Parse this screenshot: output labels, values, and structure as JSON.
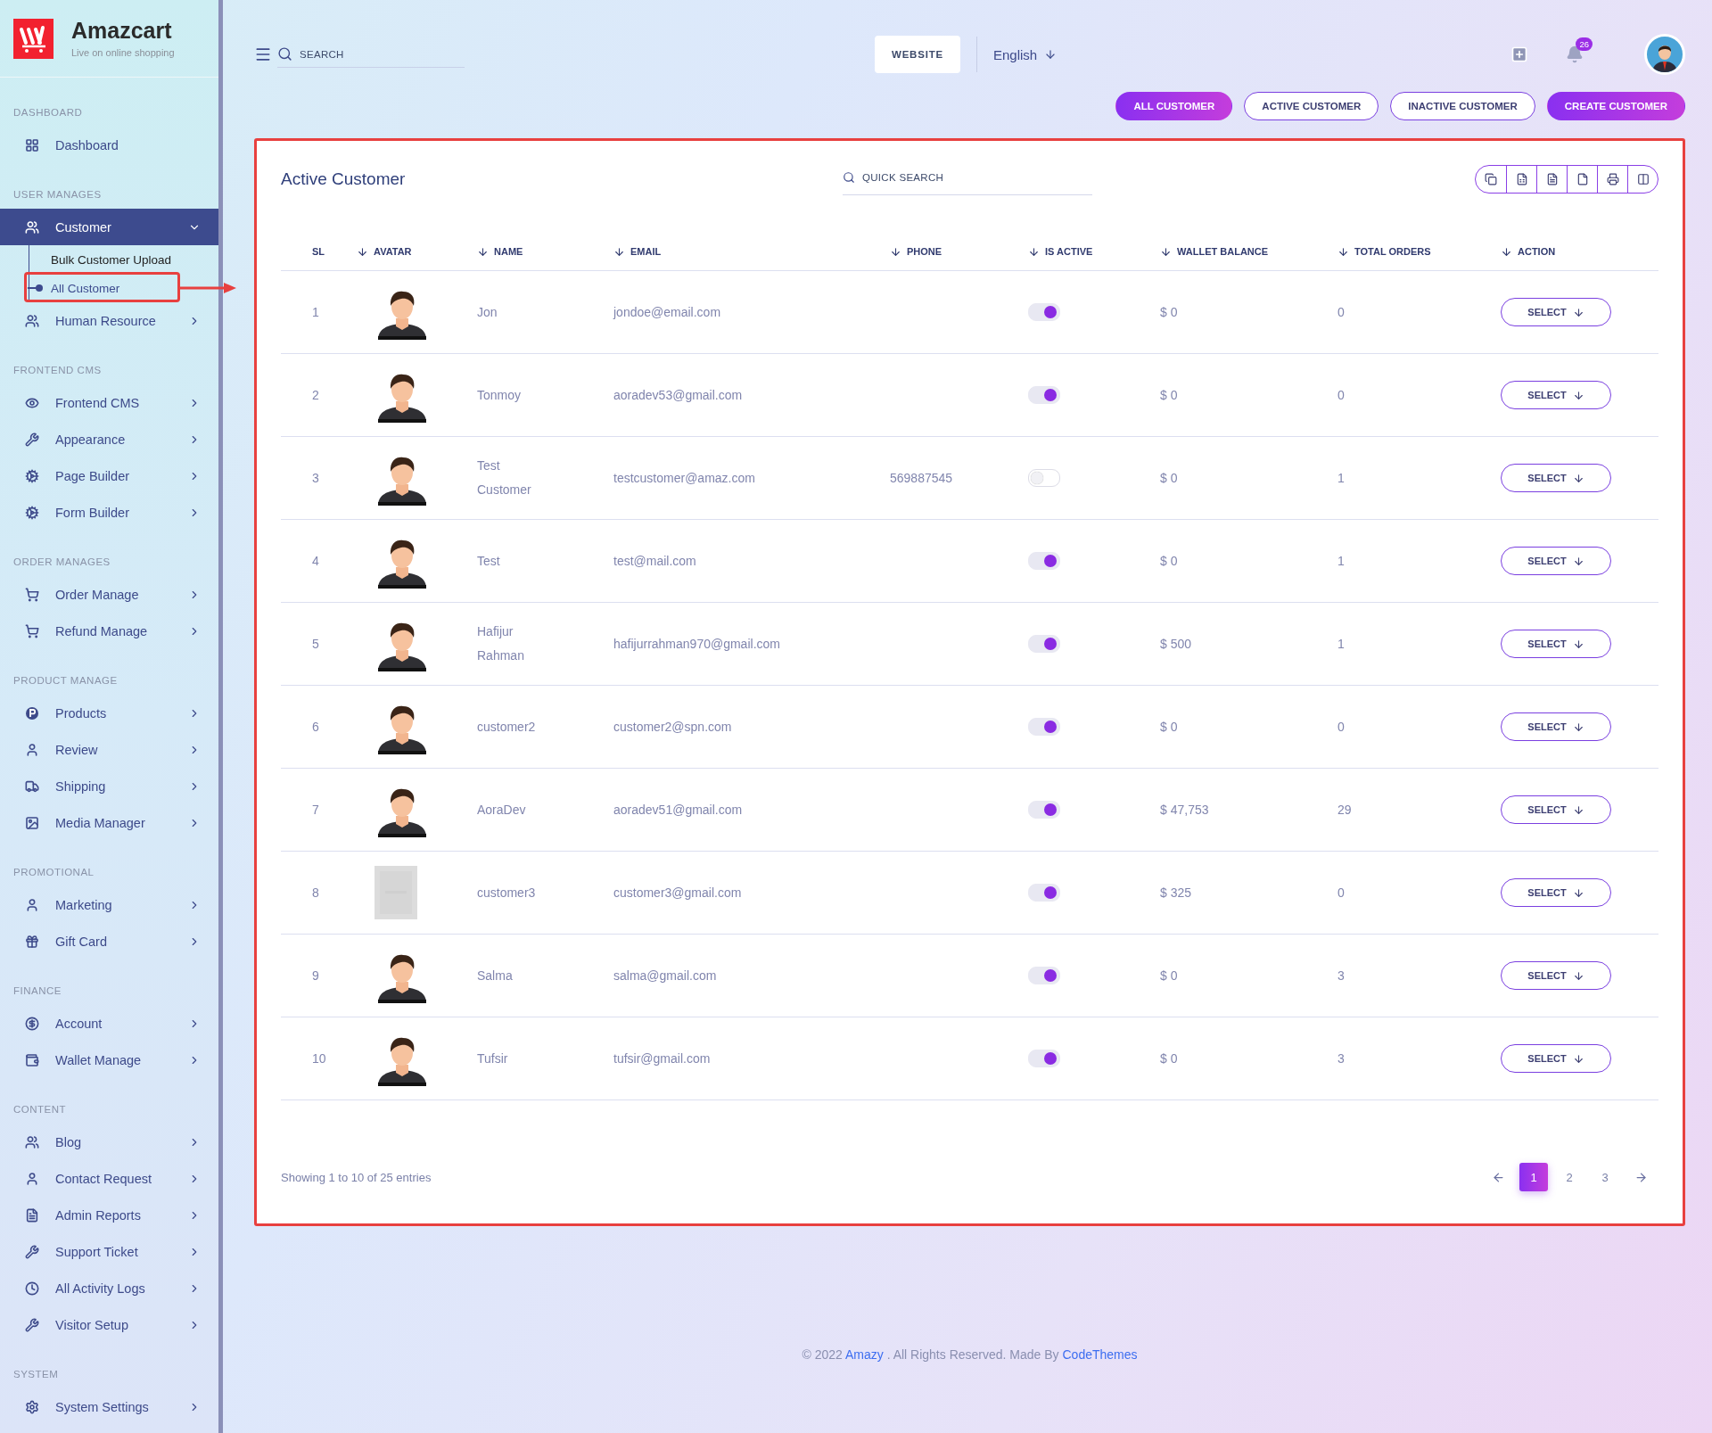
{
  "brand": {
    "name": "Amazcart",
    "tagline": "Live on online shopping"
  },
  "sidebar": {
    "sections": [
      {
        "heading": "DASHBOARD",
        "items": [
          {
            "label": "Dashboard",
            "selected": false
          }
        ]
      },
      {
        "heading": "USER MANAGES",
        "items": [
          {
            "label": "Customer",
            "selected": true,
            "expanded": true,
            "children": [
              {
                "label": "Bulk Customer Upload",
                "selected": false
              },
              {
                "label": "All Customer",
                "selected": true
              }
            ]
          },
          {
            "label": "Human Resource",
            "selected": false,
            "expanded": false
          }
        ]
      },
      {
        "heading": "FRONTEND CMS",
        "items": [
          {
            "label": "Frontend CMS",
            "selected": false,
            "expanded": false
          },
          {
            "label": "Appearance",
            "selected": false,
            "expanded": false
          },
          {
            "label": "Page Builder",
            "selected": false,
            "expanded": false
          },
          {
            "label": "Form Builder",
            "selected": false,
            "expanded": false
          }
        ]
      },
      {
        "heading": "ORDER MANAGES",
        "items": [
          {
            "label": "Order Manage",
            "selected": false,
            "expanded": false
          },
          {
            "label": "Refund Manage",
            "selected": false,
            "expanded": false
          }
        ]
      },
      {
        "heading": "PRODUCT MANAGE",
        "items": [
          {
            "label": "Products",
            "selected": false,
            "expanded": false
          },
          {
            "label": "Review",
            "selected": false,
            "expanded": false
          },
          {
            "label": "Shipping",
            "selected": false,
            "expanded": false
          },
          {
            "label": "Media Manager",
            "selected": false,
            "expanded": false
          }
        ]
      },
      {
        "heading": "PROMOTIONAL",
        "items": [
          {
            "label": "Marketing",
            "selected": false,
            "expanded": false
          },
          {
            "label": "Gift Card",
            "selected": false,
            "expanded": false
          }
        ]
      },
      {
        "heading": "FINANCE",
        "items": [
          {
            "label": "Account",
            "selected": false,
            "expanded": false
          },
          {
            "label": "Wallet Manage",
            "selected": false,
            "expanded": false
          }
        ]
      },
      {
        "heading": "CONTENT",
        "items": [
          {
            "label": "Blog",
            "selected": false,
            "expanded": false
          },
          {
            "label": "Contact Request",
            "selected": false,
            "expanded": false
          },
          {
            "label": "Admin Reports",
            "selected": false,
            "expanded": false
          },
          {
            "label": "Support Ticket",
            "selected": false,
            "expanded": false
          },
          {
            "label": "All Activity Logs",
            "selected": false,
            "expanded": false
          },
          {
            "label": "Visitor Setup",
            "selected": false,
            "expanded": false
          }
        ]
      },
      {
        "heading": "SYSTEM",
        "items": [
          {
            "label": "System Settings",
            "selected": false,
            "expanded": false
          }
        ]
      }
    ]
  },
  "header": {
    "search": {
      "placeholder": "SEARCH"
    },
    "website_button": "WEBSITE",
    "language": "English",
    "notifications": {
      "count": "26"
    }
  },
  "filters": [
    {
      "label": "ALL CUSTOMER",
      "kind": "filter",
      "selected": true
    },
    {
      "label": "ACTIVE CUSTOMER",
      "kind": "filter",
      "selected": false
    },
    {
      "label": "INACTIVE CUSTOMER",
      "kind": "filter",
      "selected": false
    },
    {
      "label": "CREATE CUSTOMER",
      "kind": "action"
    }
  ],
  "card": {
    "title": "Active Customer",
    "search": {
      "placeholder": "QUICK SEARCH"
    }
  },
  "table": {
    "columns": [
      {
        "label": "SL",
        "sortable": false
      },
      {
        "label": "AVATAR",
        "sortable": true
      },
      {
        "label": "NAME",
        "sortable": true
      },
      {
        "label": "EMAIL",
        "sortable": true
      },
      {
        "label": "PHONE",
        "sortable": true
      },
      {
        "label": "IS ACTIVE",
        "sortable": true
      },
      {
        "label": "WALLET BALANCE",
        "sortable": true
      },
      {
        "label": "TOTAL ORDERS",
        "sortable": true
      },
      {
        "label": "ACTION",
        "sortable": true
      }
    ],
    "rows": [
      {
        "sl": "1",
        "avatar": {
          "kind": "figure"
        },
        "name": "Jon",
        "email": "jondoe@email.com",
        "active": true,
        "wallet": "$ 0",
        "orders": "0",
        "action": "SELECT"
      },
      {
        "sl": "2",
        "avatar": {
          "kind": "figure"
        },
        "name": "Tonmoy",
        "email": "aoradev53@gmail.com",
        "active": true,
        "wallet": "$ 0",
        "orders": "0",
        "action": "SELECT"
      },
      {
        "sl": "3",
        "avatar": {
          "kind": "figure"
        },
        "name": "Test Customer",
        "email": "testcustomer@amaz.com",
        "phone": "569887545",
        "active": false,
        "wallet": "$ 0",
        "orders": "1",
        "action": "SELECT"
      },
      {
        "sl": "4",
        "avatar": {
          "kind": "figure"
        },
        "name": "Test",
        "email": "test@mail.com",
        "active": true,
        "wallet": "$ 0",
        "orders": "1",
        "action": "SELECT"
      },
      {
        "sl": "5",
        "avatar": {
          "kind": "figure"
        },
        "name": "Hafijur Rahman",
        "email": "hafijurrahman970@gmail.com",
        "active": true,
        "wallet": "$ 500",
        "orders": "1",
        "action": "SELECT"
      },
      {
        "sl": "6",
        "avatar": {
          "kind": "figure"
        },
        "name": "customer2",
        "email": "customer2@spn.com",
        "active": true,
        "wallet": "$ 0",
        "orders": "0",
        "action": "SELECT"
      },
      {
        "sl": "7",
        "avatar": {
          "kind": "figure"
        },
        "name": "AoraDev",
        "email": "aoradev51@gmail.com",
        "active": true,
        "wallet": "$ 47,753",
        "orders": "29",
        "action": "SELECT"
      },
      {
        "sl": "8",
        "name": "customer3",
        "email": "customer3@gmail.com",
        "active": true,
        "wallet": "$ 325",
        "orders": "0",
        "action": "SELECT"
      },
      {
        "sl": "9",
        "avatar": {
          "kind": "figure"
        },
        "name": "Salma",
        "email": "salma@gmail.com",
        "active": true,
        "wallet": "$ 0",
        "orders": "3",
        "action": "SELECT"
      },
      {
        "sl": "10",
        "avatar": {
          "kind": "figure"
        },
        "name": "Tufsir",
        "email": "tufsir@gmail.com",
        "active": true,
        "wallet": "$ 0",
        "orders": "3",
        "action": "SELECT"
      }
    ]
  },
  "pagination": {
    "info": "Showing 1 to 10 of 25 entries",
    "pages": [
      {
        "label": "1",
        "selected": true
      },
      {
        "label": "2",
        "selected": false
      },
      {
        "label": "3",
        "selected": false
      }
    ]
  },
  "footer": {
    "copyright": "© 2022",
    "site_link": "Amazy",
    "rights": ". All Rights Reserved. Made By",
    "author_link": "CodeThemes"
  }
}
